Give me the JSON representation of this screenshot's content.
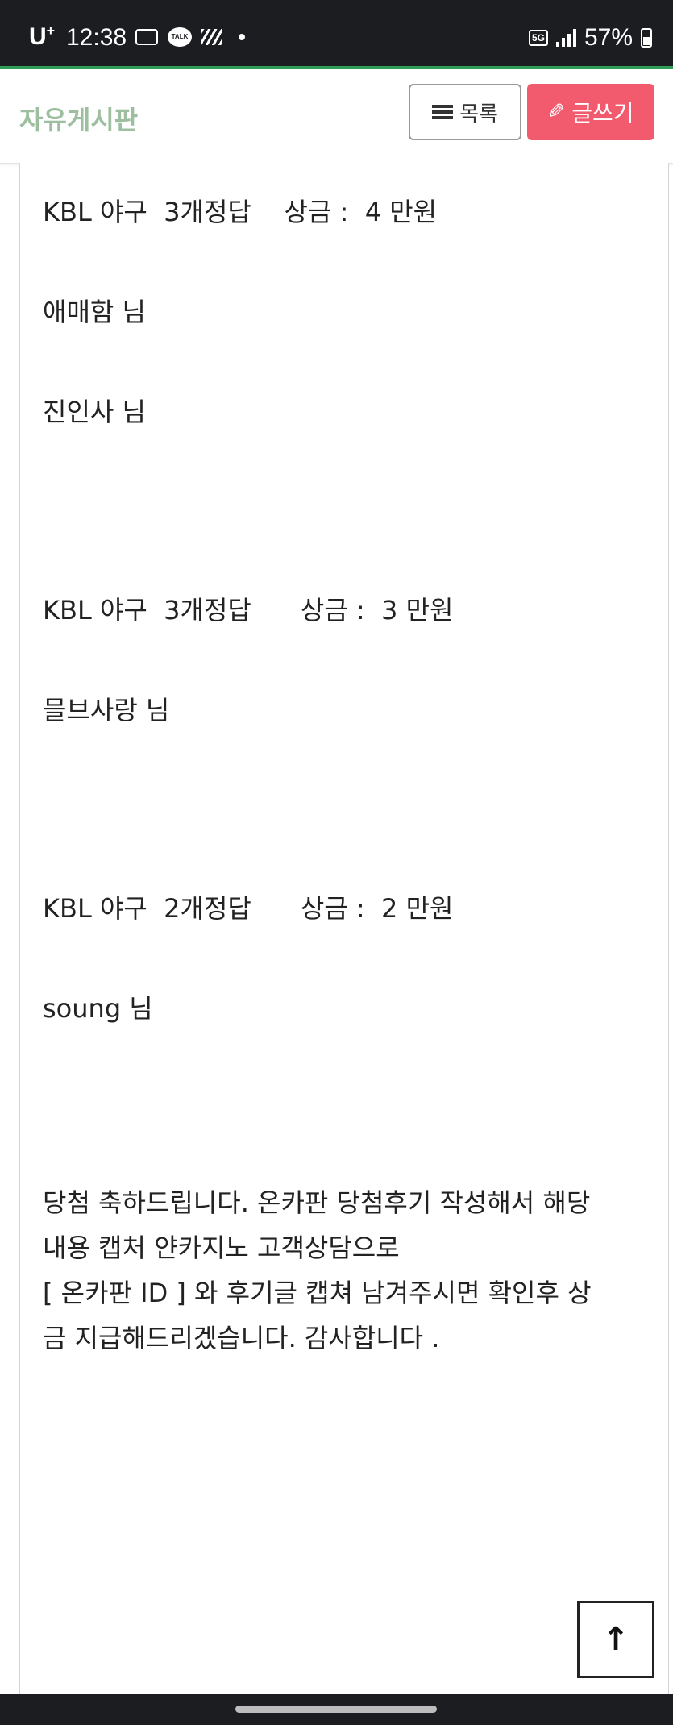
{
  "status_bar": {
    "carrier": "U",
    "carrier_sup": "+",
    "time": "12:38",
    "network": "5G",
    "battery": "57%"
  },
  "header": {
    "board_title": "자유게시판",
    "list_button": "목록",
    "write_button": "글쓰기"
  },
  "post": {
    "lines": [
      "KBL 야구  3개정답    상금 :  4 만원",
      "애매함 님",
      "진인사 님",
      "KBL 야구  3개정답      상금 :  3 만원",
      "믈브사랑 님",
      "KBL 야구  2개정답      상금 :  2 만원",
      "soung 님"
    ],
    "closing": [
      "당첨 축하드립니다. 온카판 당첨후기 작성해서 해당",
      "내용 캡처 얀카지노 고객상담으로",
      "[ 온카판 ID ] 와 후기글 캡쳐 남겨주시면 확인후 상",
      "금 지급해드리겠습니다. 감사합니다 ."
    ]
  },
  "scroll_top": "↑",
  "colors": {
    "accent_green": "#2f9c56",
    "title_green": "#9dbf9f",
    "write_button": "#f25b6e"
  }
}
